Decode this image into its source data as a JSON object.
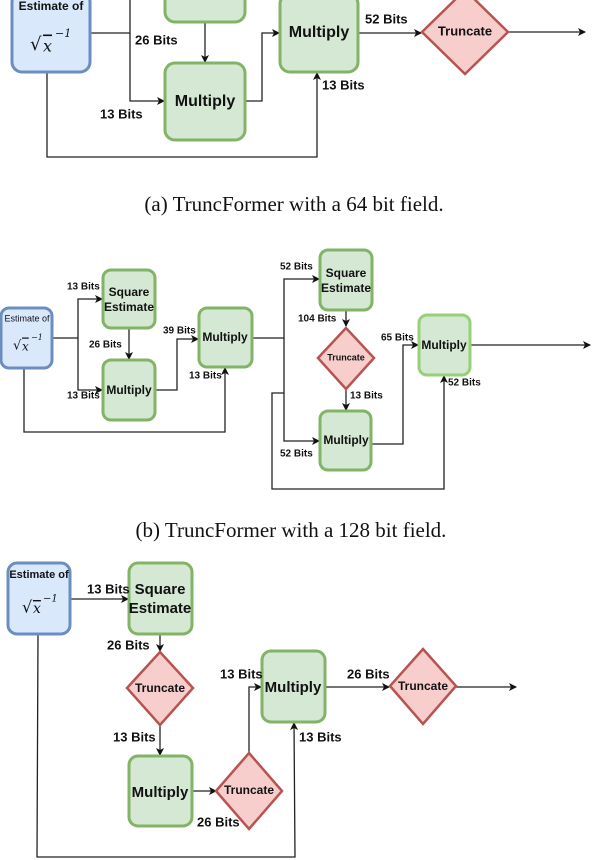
{
  "estimate": {
    "title": "Estimate of",
    "sqrt": "√",
    "var": "x",
    "exp": "−1"
  },
  "ops": {
    "square_line1": "Square",
    "square_line2": "Estimate",
    "multiply": "Multiply",
    "truncate": "Truncate"
  },
  "colors": {
    "input_fill": "#dae8fc",
    "input_stroke": "#6c8ebf",
    "op_fill": "#d5e8d4",
    "op_stroke": "#82b366",
    "trunc_fill": "#f8cecc",
    "trunc_stroke": "#b85450"
  },
  "panel_a": {
    "caption": "(a) TruncFormer with a 64 bit field.",
    "labels": [
      "26 Bits",
      "13 Bits",
      "52 Bits",
      "13 Bits"
    ]
  },
  "panel_b": {
    "caption": "(b) TruncFormer with a 128 bit field.",
    "labels": [
      "13 Bits",
      "26 Bits",
      "13 Bits",
      "39 Bits",
      "13 Bits",
      "52 Bits",
      "104 Bits",
      "13 Bits",
      "52 Bits",
      "65 Bits",
      "52 Bits"
    ]
  },
  "panel_c": {
    "labels": [
      "13 Bits",
      "26 Bits",
      "13 Bits",
      "26 Bits",
      "13 Bits",
      "26 Bits",
      "13 Bits"
    ]
  }
}
